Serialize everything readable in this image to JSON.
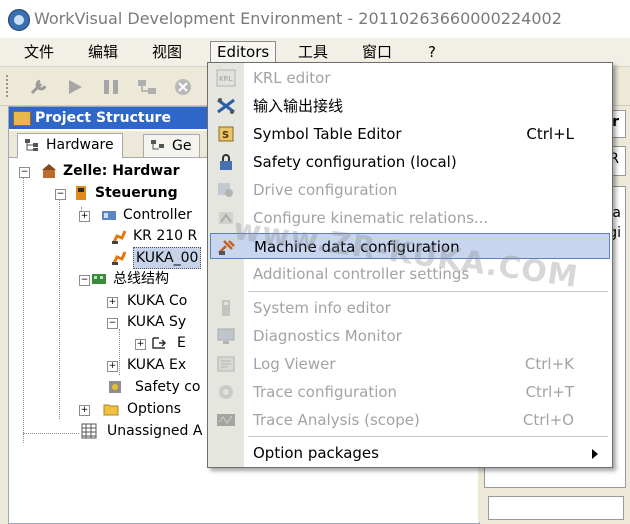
{
  "window": {
    "title": "WorkVisual Development Environment - 20110263660000224002"
  },
  "menubar": {
    "items": [
      "文件",
      "编辑",
      "视图",
      "Editors",
      "工具",
      "窗口",
      "?"
    ]
  },
  "panel": {
    "title": "Project Structure",
    "tabs": [
      "Hardware",
      "Ge"
    ]
  },
  "tree": {
    "nodes": [
      "Zelle: Hardwar",
      "Steuerung",
      "Controller",
      "KR 210 R",
      "KUKA_00",
      "总线结构",
      "KUKA Co",
      "KUKA Sy",
      "E",
      "KUKA Ex",
      "Safety co",
      "Options",
      "Unassigned A"
    ]
  },
  "right_panel": {
    "fragments": [
      "ir",
      "R",
      "na",
      "gi"
    ]
  },
  "editors_menu": {
    "items": [
      {
        "label": "KRL editor",
        "shortcut": ""
      },
      {
        "label": "输入输出接线",
        "shortcut": ""
      },
      {
        "label": "Symbol Table Editor",
        "shortcut": "Ctrl+L"
      },
      {
        "label": "Safety configuration (local)",
        "shortcut": ""
      },
      {
        "label": "Drive configuration",
        "shortcut": ""
      },
      {
        "label": "Configure kinematic relations...",
        "shortcut": ""
      },
      {
        "label": "Machine data configuration",
        "shortcut": ""
      },
      {
        "label": "Additional controller settings",
        "shortcut": ""
      },
      {
        "label": "System info editor",
        "shortcut": ""
      },
      {
        "label": "Diagnostics Monitor",
        "shortcut": ""
      },
      {
        "label": "Log Viewer",
        "shortcut": "Ctrl+K"
      },
      {
        "label": "Trace configuration",
        "shortcut": "Ctrl+T"
      },
      {
        "label": "Trace Analysis (scope)",
        "shortcut": "Ctrl+O"
      },
      {
        "label": "Option packages",
        "shortcut": ""
      }
    ]
  },
  "watermark": "www.ZR-KUKA.COM",
  "colors": {
    "panel_header": "#2f66c9",
    "highlight": "#c7d6ee",
    "disabled_text": "#a3a3a3"
  }
}
